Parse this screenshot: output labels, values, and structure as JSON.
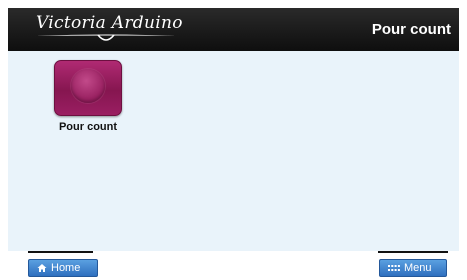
{
  "header": {
    "logo_text": "Victoria Arduino",
    "title": "Pour count"
  },
  "apps": [
    {
      "label": "Pour count",
      "icon": "circle-app-icon"
    }
  ],
  "footer": {
    "home_label": "Home",
    "home_icon": "home-icon",
    "menu_label": "Menu",
    "menu_icon": "grid-dots-icon"
  },
  "colors": {
    "header_bg": "#1a1a1a",
    "content_bg": "#e9f3fa",
    "button_blue": "#3f86d3",
    "app_tile": "#9a1e62"
  }
}
